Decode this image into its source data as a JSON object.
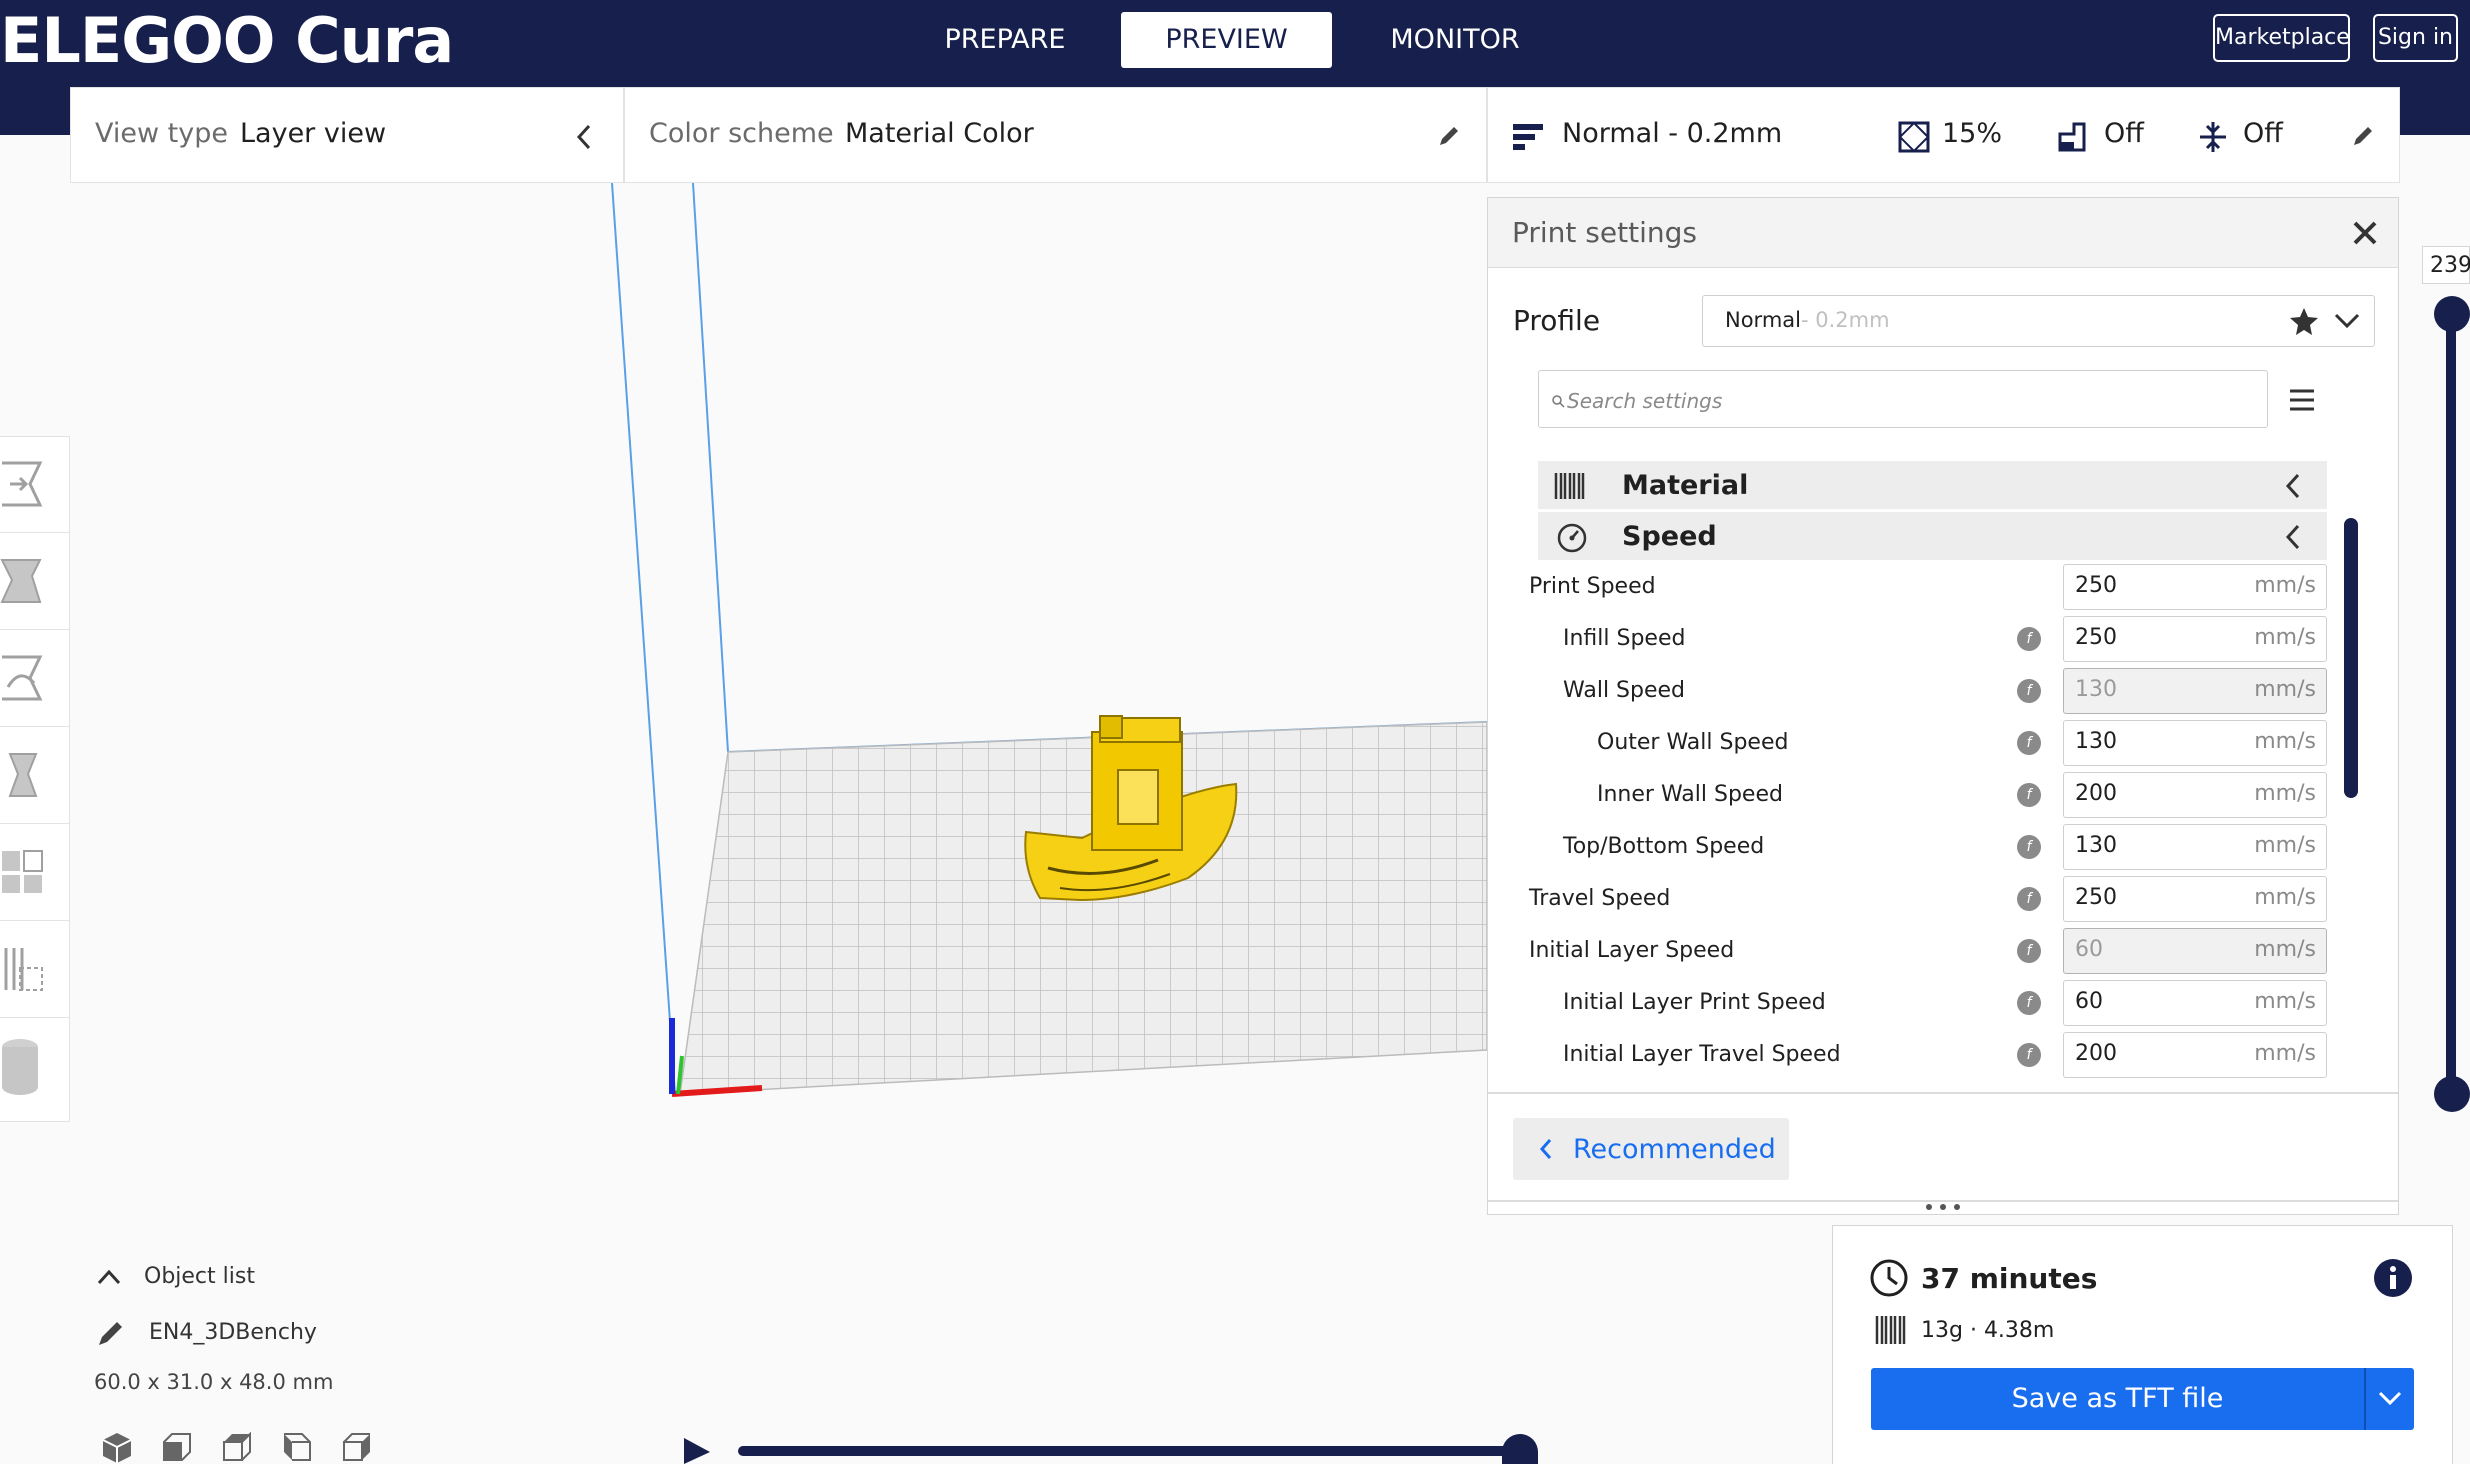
{
  "app": {
    "logo": "ELEGOO Cura",
    "stages": [
      "PREPARE",
      "PREVIEW",
      "MONITOR"
    ],
    "active_stage": "PREVIEW",
    "marketplace_label": "Marketplace",
    "signin_label": "Sign in"
  },
  "view_bar": {
    "view_type_label": "View type",
    "view_type_value": "Layer view",
    "color_scheme_label": "Color scheme",
    "color_scheme_value": "Material Color"
  },
  "settings_summary": {
    "profile": "Normal - 0.2mm",
    "infill": "15%",
    "support": "Off",
    "adhesion": "Off"
  },
  "print_settings": {
    "title": "Print settings",
    "profile_label": "Profile",
    "profile_name": "Normal",
    "profile_suffix": " - 0.2mm",
    "search_placeholder": "Search settings",
    "categories": [
      "Material",
      "Speed"
    ],
    "rows": [
      {
        "label": "Print Speed",
        "value": "250",
        "unit": "mm/s"
      },
      {
        "label": "Infill Speed",
        "value": "250",
        "unit": "mm/s"
      },
      {
        "label": "Wall Speed",
        "value": "130",
        "unit": "mm/s"
      },
      {
        "label": "Outer Wall Speed",
        "value": "130",
        "unit": "mm/s"
      },
      {
        "label": "Inner Wall Speed",
        "value": "200",
        "unit": "mm/s"
      },
      {
        "label": "Top/Bottom Speed",
        "value": "130",
        "unit": "mm/s"
      },
      {
        "label": "Travel Speed",
        "value": "250",
        "unit": "mm/s"
      },
      {
        "label": "Initial Layer Speed",
        "value": "60",
        "unit": "mm/s"
      },
      {
        "label": "Initial Layer Print Speed",
        "value": "60",
        "unit": "mm/s"
      },
      {
        "label": "Initial Layer Travel Speed",
        "value": "200",
        "unit": "mm/s"
      }
    ],
    "recommended_label": "Recommended"
  },
  "object_list": {
    "header": "Object list",
    "object_name": "EN4_3DBenchy",
    "dimensions": "60.0 x 31.0 x 48.0 mm"
  },
  "output": {
    "print_time": "37 minutes",
    "material_usage": "13g · 4.38m",
    "save_label": "Save as TFT file"
  },
  "layer_slider": {
    "top_layer": "239"
  },
  "colors": {
    "header": "#171f4d",
    "accent": "#196ef0",
    "model": "#f5d014"
  }
}
